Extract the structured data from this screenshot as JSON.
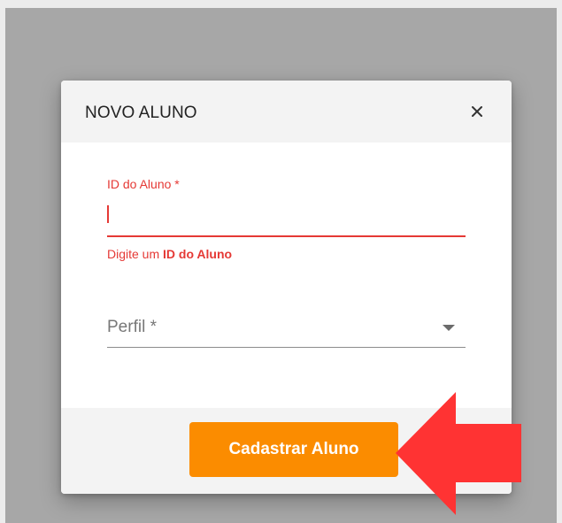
{
  "dialog": {
    "title": "NOVO ALUNO",
    "close_icon": "close-icon",
    "close_symbol": "×"
  },
  "fields": {
    "student_id": {
      "label": "ID do Aluno *",
      "value": "",
      "error_prefix": "Digite um ",
      "error_emphasis": "ID do Aluno"
    },
    "profile": {
      "label": "Perfil *",
      "icon": "chevron-down-icon"
    }
  },
  "actions": {
    "submit_label": "Cadastrar Aluno"
  },
  "annotation": {
    "icon": "red-arrow-icon"
  },
  "colors": {
    "accent": "#fb8c00",
    "error": "#e53935",
    "overlay": "#a7a7a7",
    "annotation": "#ff3333"
  }
}
